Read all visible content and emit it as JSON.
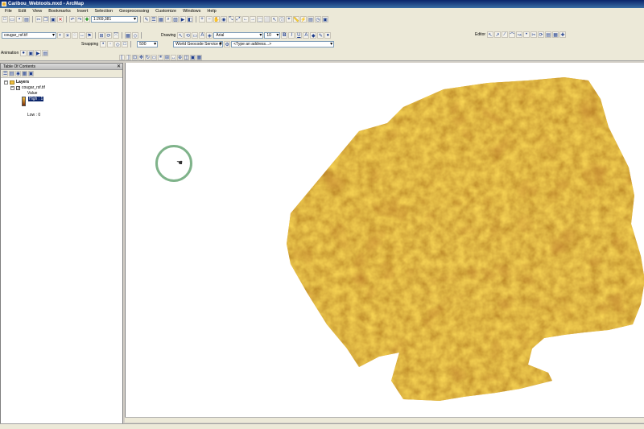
{
  "window": {
    "title": "Caribou_Webtools.mxd - ArcMap"
  },
  "menu": [
    "File",
    "Edit",
    "View",
    "Bookmarks",
    "Insert",
    "Selection",
    "Geoprocessing",
    "Customize",
    "Windows",
    "Help"
  ],
  "toolbar": {
    "scale": "1:269,381",
    "layer_combo": "cougar_rsf.tif",
    "snapping_label": "Snapping",
    "snap_tolerance": "500",
    "drawing_label": "Drawing",
    "font_name": "Arial",
    "font_size": "10",
    "bold": "B",
    "italic": "I",
    "underline": "U",
    "geocode_service": "World Geocode Service (F",
    "address_placeholder": "<Type an address...>",
    "editor_label": "Editor",
    "animation_label": "Animation"
  },
  "toc": {
    "title": "Table Of Contents",
    "layers_label": "Layers",
    "layer_name": "cougar_rsf.tif",
    "value_label": "Value",
    "high_label": "High : 1",
    "low_label": "Low : 0"
  },
  "colors": {
    "raster_high": "#f6c040",
    "raster_low": "#7a2b05",
    "cursor_ring": "#7fb38a"
  },
  "icons": [
    "app-icon",
    "hand-pan-icon",
    "zoom-in-icon",
    "zoom-out-icon",
    "identify-icon",
    "close-icon"
  ]
}
